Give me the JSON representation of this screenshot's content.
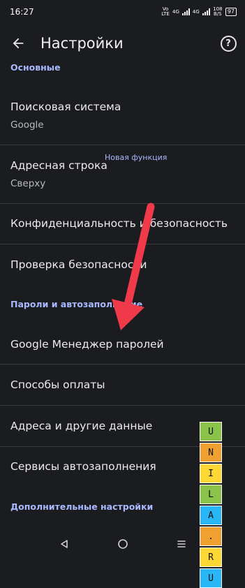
{
  "status_bar": {
    "time": "16:27",
    "net_1": "Vo LTE",
    "net_2": "4G",
    "net_3": "4G",
    "speed": "108 B/S",
    "battery": "97"
  },
  "app_bar": {
    "title": "Настройки"
  },
  "sections": {
    "basic": "Основные",
    "passwords": "Пароли и автозаполнение",
    "advanced": "Дополнительные настройки"
  },
  "items": {
    "search_engine": {
      "title": "Поисковая система",
      "value": "Google"
    },
    "address_bar": {
      "title": "Адресная строка",
      "value": "Сверху",
      "badge": "Новая функция"
    },
    "privacy": {
      "title": "Конфиденциальность и безопасность"
    },
    "safety_check": {
      "title": "Проверка безопасности"
    },
    "password_manager": {
      "title": "Google Менеджер паролей"
    },
    "payment_methods": {
      "title": "Способы оплаты"
    },
    "addresses": {
      "title": "Адреса и другие данные"
    },
    "autofill_services": {
      "title": "Сервисы автозаполнения"
    }
  },
  "watermark": {
    "letters": [
      "U",
      "N",
      "I",
      "L",
      "A",
      ".",
      "R",
      "U"
    ],
    "colors": [
      "#8bc34a",
      "#f0a030",
      "#fdd835",
      "#8bc34a",
      "#29b6f6",
      "#f0a030",
      "#fdd835",
      "#29b6f6"
    ]
  },
  "colors": {
    "accent": "#a9b8ff",
    "background": "#1b1c1f",
    "arrow": "#f03a4a"
  },
  "icons": {
    "back": "arrow-back-icon",
    "help": "help-circle-icon",
    "nav_back": "triangle-back-icon",
    "nav_home": "circle-home-icon",
    "nav_menu": "menu-lines-icon"
  }
}
